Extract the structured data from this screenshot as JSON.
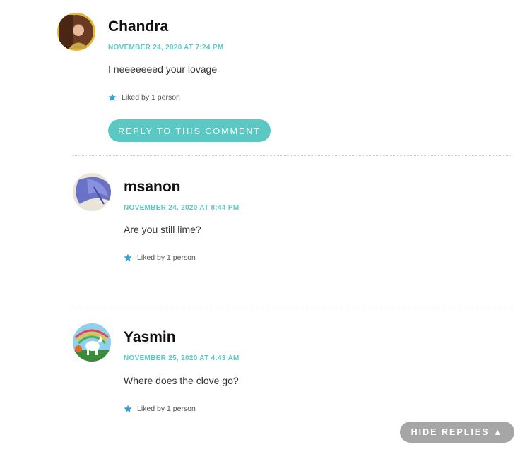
{
  "colors": {
    "accent": "#5bc8c4",
    "date": "#5bc8c4",
    "hide_replies_bg": "#a6a6a6",
    "avatar_ring": "#e3b93a"
  },
  "comments": [
    {
      "author": "Chandra",
      "date": "NOVEMBER 24, 2020 AT 7:24 PM",
      "text": "I neeeeeeed your lovage",
      "likes": "Liked by 1 person",
      "reply_label": "REPLY TO THIS COMMENT"
    },
    {
      "author": "msanon",
      "date": "NOVEMBER 24, 2020 AT 8:44 PM",
      "text": "Are you still lime?",
      "likes": "Liked by 1 person"
    },
    {
      "author": "Yasmin",
      "date": "NOVEMBER 25, 2020 AT 4:43 AM",
      "text": "Where does the clove go?",
      "likes": "Liked by 1 person"
    }
  ],
  "hide_replies": {
    "label": "HIDE REPLIES ▲"
  }
}
